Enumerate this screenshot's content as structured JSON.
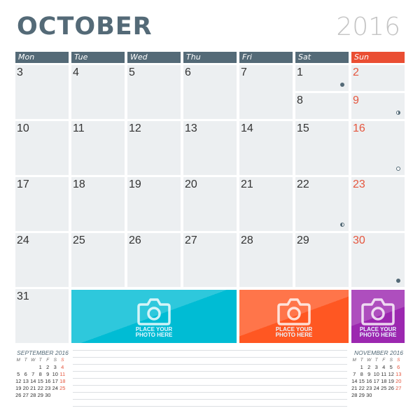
{
  "header": {
    "month": "OCTOBER",
    "year": "2016"
  },
  "colors": {
    "accent": "#546a77",
    "sunday": "#ea4e33",
    "cell": "#eceff1",
    "photo1": "#00bcd4",
    "photo2": "#ff5722",
    "photo3": "#9c27b0"
  },
  "weekdays": [
    "Mon",
    "Tue",
    "Wed",
    "Thu",
    "Fri",
    "Sat",
    "Sun"
  ],
  "days": [
    1,
    2,
    3,
    4,
    5,
    6,
    7,
    8,
    9,
    10,
    11,
    12,
    13,
    14,
    15,
    16,
    17,
    18,
    19,
    20,
    21,
    22,
    23,
    24,
    25,
    26,
    27,
    28,
    29,
    30,
    31
  ],
  "moon_phases": [
    {
      "day": 1,
      "phase": "new"
    },
    {
      "day": 9,
      "phase": "first-quarter"
    },
    {
      "day": 16,
      "phase": "full"
    },
    {
      "day": 22,
      "phase": "last-quarter"
    },
    {
      "day": 30,
      "phase": "new"
    }
  ],
  "photo_placeholders": [
    {
      "text1": "PLACE YOUR",
      "text2": "PHOTO HERE",
      "color": "#00bcd4",
      "icon": "camera-icon"
    },
    {
      "text1": "PLACE YOUR",
      "text2": "PHOTO HERE",
      "color": "#ff5722",
      "icon": "camera-icon"
    },
    {
      "text1": "PLACE YOUR",
      "text2": "PHOTO HERE",
      "color": "#9c27b0",
      "icon": "camera-icon"
    }
  ],
  "mini_calendars": [
    {
      "title": "SEPTEMBER 2016",
      "letters": [
        "M",
        "T",
        "W",
        "T",
        "F",
        "S",
        "S"
      ],
      "weeks": [
        [
          "",
          "",
          "",
          "1",
          "2",
          "3",
          "4"
        ],
        [
          "5",
          "6",
          "7",
          "8",
          "9",
          "10",
          "11"
        ],
        [
          "12",
          "13",
          "14",
          "15",
          "16",
          "17",
          "18"
        ],
        [
          "19",
          "20",
          "21",
          "22",
          "23",
          "24",
          "25"
        ],
        [
          "26",
          "27",
          "28",
          "29",
          "30",
          "",
          ""
        ]
      ]
    },
    {
      "title": "NOVEMBER 2016",
      "letters": [
        "M",
        "T",
        "W",
        "T",
        "F",
        "S",
        "S"
      ],
      "weeks": [
        [
          "",
          "1",
          "2",
          "3",
          "4",
          "5",
          "6"
        ],
        [
          "7",
          "8",
          "9",
          "10",
          "11",
          "12",
          "13"
        ],
        [
          "14",
          "15",
          "16",
          "17",
          "18",
          "19",
          "20"
        ],
        [
          "21",
          "22",
          "23",
          "24",
          "25",
          "26",
          "27"
        ],
        [
          "28",
          "29",
          "30",
          "",
          "",
          "",
          ""
        ]
      ]
    }
  ]
}
